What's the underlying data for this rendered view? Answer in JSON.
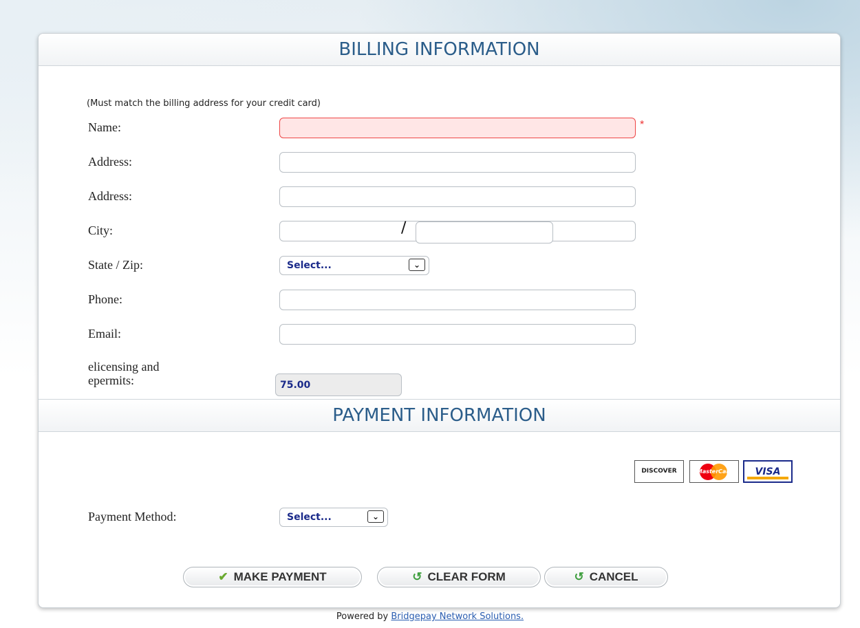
{
  "billing": {
    "title": "BILLING INFORMATION",
    "note": "(Must match the billing address for your credit card)",
    "fields": {
      "name_label": "Name:",
      "required_mark": "*",
      "address1_label": "Address:",
      "address2_label": "Address:",
      "city_label": "City:",
      "state_zip_label": "State / Zip:",
      "state_select_value": "Select...",
      "state_zip_separator": "/",
      "phone_label": "Phone:",
      "email_label": "Email:",
      "amount_label_line1": "elicensing and",
      "amount_label_line2": "epermits:",
      "amount_value": "75.00"
    }
  },
  "payment": {
    "title": "PAYMENT INFORMATION",
    "cards": [
      "DISCOVER",
      "MasterCard",
      "VISA"
    ],
    "method_label": "Payment Method:",
    "method_select_value": "Select..."
  },
  "buttons": {
    "make_payment": "MAKE PAYMENT",
    "clear_form": "CLEAR FORM",
    "cancel": "CANCEL"
  },
  "footer": {
    "prefix": "Powered by",
    "link": "Bridgepay Network Solutions."
  },
  "colors": {
    "header_text": "#2b5d8a",
    "required_border": "#e44",
    "select_text": "#1a2a8a"
  }
}
